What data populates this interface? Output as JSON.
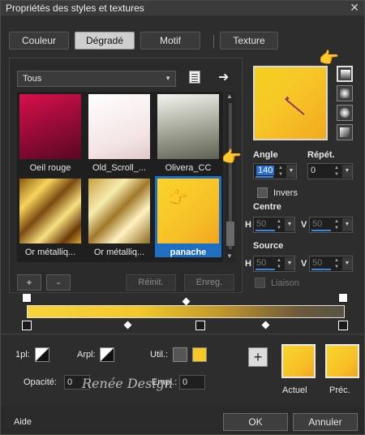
{
  "window": {
    "title": "Propriétés des styles et textures",
    "close": "✕"
  },
  "tabs": [
    "Couleur",
    "Dégradé",
    "Motif",
    "Texture"
  ],
  "category": {
    "selected": "Tous"
  },
  "gradients": [
    {
      "label": "Oeil rouge",
      "colors": [
        "#d8104a",
        "#6a0a2a"
      ]
    },
    {
      "label": "Old_Scroll_...",
      "colors": [
        "#ffffff",
        "#e8cfcf"
      ]
    },
    {
      "label": "Olivera_CC",
      "colors": [
        "#f0f0ea",
        "#6a6e5e"
      ]
    },
    {
      "label": "Or métalliq...",
      "colors": [
        "#f6d45a",
        "#7a4a10"
      ]
    },
    {
      "label": "Or métalliq...",
      "colors": [
        "#f0e2a0",
        "#8a6a20"
      ]
    },
    {
      "label": "panache",
      "colors": [
        "#f9d42c",
        "#f2a620"
      ]
    }
  ],
  "buttons": {
    "add": "+",
    "remove": "-",
    "reset": "Réinit.",
    "save": "Enreg."
  },
  "angle": {
    "label": "Angle",
    "value": "140"
  },
  "repeat": {
    "label": "Répét.",
    "value": "0"
  },
  "invert": {
    "label": "Invers"
  },
  "centre": {
    "label": "Centre",
    "h_label": "H",
    "h": "50",
    "v_label": "V",
    "v": "50"
  },
  "source": {
    "label": "Source",
    "h_label": "H",
    "h": "50",
    "v_label": "V",
    "v": "50"
  },
  "link": {
    "label": "Liaison"
  },
  "bottom": {
    "first_label": "1pl:",
    "arpl_label": "Arpl:",
    "util_label": "Util.:",
    "opacity_label": "Opacité:",
    "opacity_value": "0",
    "empl_label": "Empl.:",
    "empl_value": "0",
    "actual_label": "Actuel",
    "prev_label": "Préc.",
    "help": "Aide",
    "ok": "OK",
    "cancel": "Annuler"
  },
  "watermark": "Renée Design",
  "colors": {
    "accent": "#1e6fc4",
    "gold": "#f6c727"
  }
}
